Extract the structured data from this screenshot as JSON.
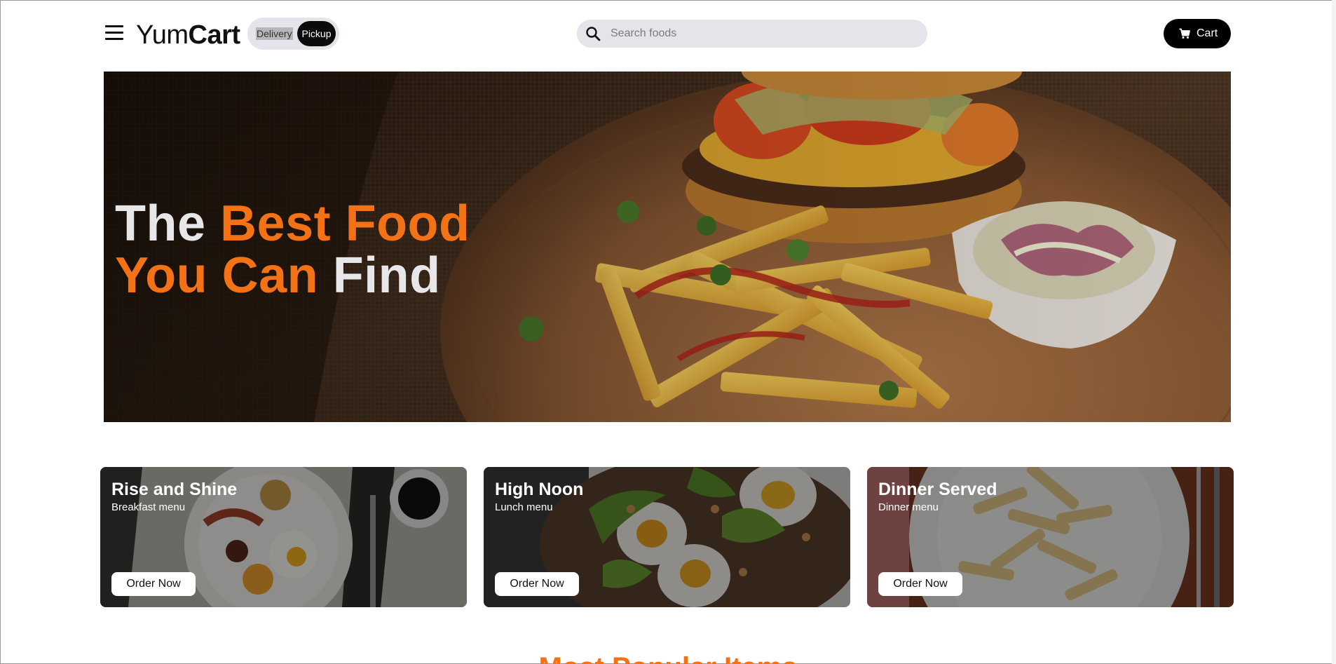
{
  "header": {
    "logo_light": "Yum",
    "logo_bold": "Cart",
    "delivery_label": "Delivery",
    "pickup_label": "Pickup",
    "search_placeholder": "Search foods",
    "cart_label": "Cart"
  },
  "hero": {
    "line1_white": "The",
    "line1_orange": "Best Food",
    "line2_orange": "You Can",
    "line2_white": "Find"
  },
  "menus": [
    {
      "title": "Rise and Shine",
      "subtitle": "Breakfast menu",
      "button": "Order Now"
    },
    {
      "title": "High Noon",
      "subtitle": "Lunch menu",
      "button": "Order Now"
    },
    {
      "title": "Dinner Served",
      "subtitle": "Dinner menu",
      "button": "Order Now"
    }
  ],
  "next_section_heading": "Most Popular Items",
  "colors": {
    "accent": "#f47216",
    "dark": "#000000",
    "pill_bg": "#e4e5ea"
  },
  "icons": {
    "menu": "hamburger-icon",
    "search": "search-icon",
    "cart": "cart-icon"
  }
}
